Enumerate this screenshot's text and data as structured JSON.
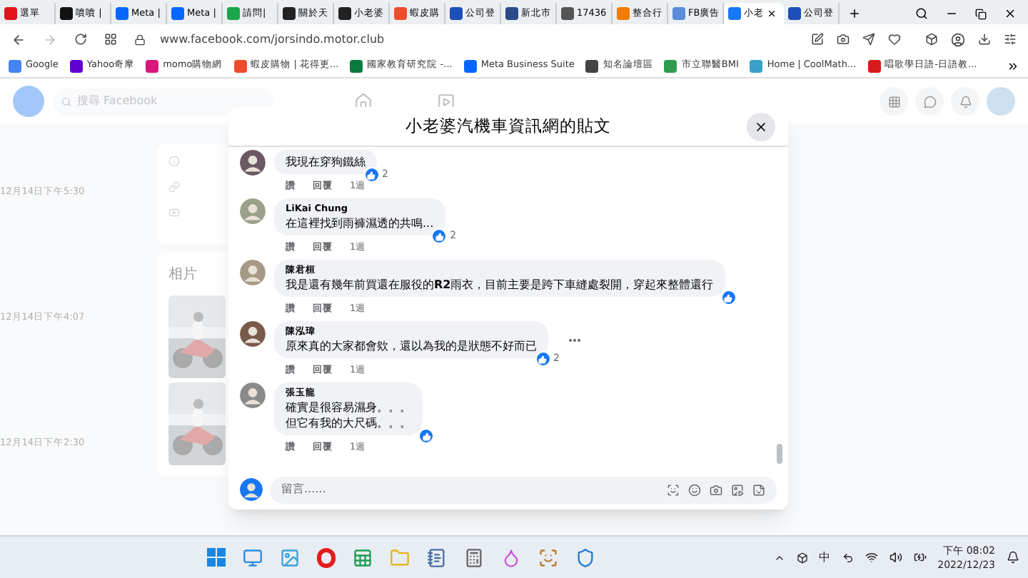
{
  "browser": {
    "tabs": [
      {
        "label": "選單",
        "selected": false,
        "color": "#e0161c"
      },
      {
        "label": "噴噴 |",
        "selected": false,
        "color": "#111111"
      },
      {
        "label": "Meta |",
        "selected": false,
        "color": "#0866ff"
      },
      {
        "label": "Meta |",
        "selected": false,
        "color": "#0866ff"
      },
      {
        "label": "請問|",
        "selected": false,
        "color": "#1aa64a"
      },
      {
        "label": "關於天",
        "selected": false,
        "color": "#222222"
      },
      {
        "label": "小老婆",
        "selected": false,
        "color": "#222222"
      },
      {
        "label": "蝦皮購",
        "selected": false,
        "color": "#ee4d2d"
      },
      {
        "label": "公司登",
        "selected": false,
        "color": "#1d4fb8"
      },
      {
        "label": "新北市",
        "selected": false,
        "color": "#2a4a8a"
      },
      {
        "label": "17436",
        "selected": false,
        "color": "#555555"
      },
      {
        "label": "整合行",
        "selected": false,
        "color": "#f07c00"
      },
      {
        "label": "FB廣告",
        "selected": false,
        "color": "#5b8bd9"
      },
      {
        "label": "小老",
        "selected": true,
        "color": "#1877f2"
      },
      {
        "label": "公司登",
        "selected": false,
        "color": "#1d4fb8"
      }
    ],
    "address": "www.facebook.com/jorsindo.motor.club",
    "bookmarks": [
      {
        "label": "Google",
        "color": "#4285f4"
      },
      {
        "label": "Yahoo奇摩",
        "color": "#6001d2"
      },
      {
        "label": "momo購物網",
        "color": "#d6187c"
      },
      {
        "label": "蝦皮購物 | 花得更...",
        "color": "#ee4d2d"
      },
      {
        "label": "國家教育研究院 -...",
        "color": "#0b7a3e"
      },
      {
        "label": "Meta Business Suite",
        "color": "#0866ff"
      },
      {
        "label": "知名論壇區",
        "color": "#444444"
      },
      {
        "label": "市立聯醫BMI",
        "color": "#2e9b4f"
      },
      {
        "label": "Home | CoolMath...",
        "color": "#3aa0c8"
      },
      {
        "label": "唱歌學日語-日語教...",
        "color": "#d81b1b"
      }
    ]
  },
  "page": {
    "search": {
      "placeholder": "搜尋 Facebook"
    },
    "timestamps": [
      "12月14日下午5:30",
      "12月14日下午4:07",
      "12月14日下午2:30"
    ],
    "photos_title": "相片"
  },
  "dialog": {
    "title": "小老婆汽機車資訊網的貼文",
    "comments": [
      {
        "lines": [
          "我現在穿狗鐵絲"
        ],
        "likes": "2",
        "actions": [
          "讚",
          "回覆",
          "1週"
        ],
        "more": false
      },
      {
        "name": "LiKai Chung",
        "lines": [
          "在這裡找到雨褲濕透的共鳴..."
        ],
        "likes": "2",
        "actions": [
          "讚",
          "回覆",
          "1週"
        ],
        "more": false
      },
      {
        "name": "陳君桓",
        "lines": [
          "我是還有幾年前買還在服役的**R2**雨衣，目前主要是跨下車縫處裂開，穿起來整體還行"
        ],
        "actions": [
          "讚",
          "回覆",
          "1週"
        ],
        "more": false
      },
      {
        "name": "陳泓瑋",
        "lines": [
          "原來真的大家都會欸，還以為我的是狀態不好而已"
        ],
        "likes": "2",
        "actions": [
          "讚",
          "回覆",
          "1週"
        ],
        "more": true
      },
      {
        "name": "張玉龍",
        "lines": [
          "確實是很容易濕身。。。",
          "但它有我的大尺碼。。。"
        ],
        "actions": [
          "讚",
          "回覆",
          "1週"
        ],
        "more": false
      }
    ],
    "composer": {
      "placeholder": "留言......"
    }
  },
  "taskbar": {
    "ime": "中",
    "time": "下午 08:02",
    "date": "2022/12/23"
  }
}
